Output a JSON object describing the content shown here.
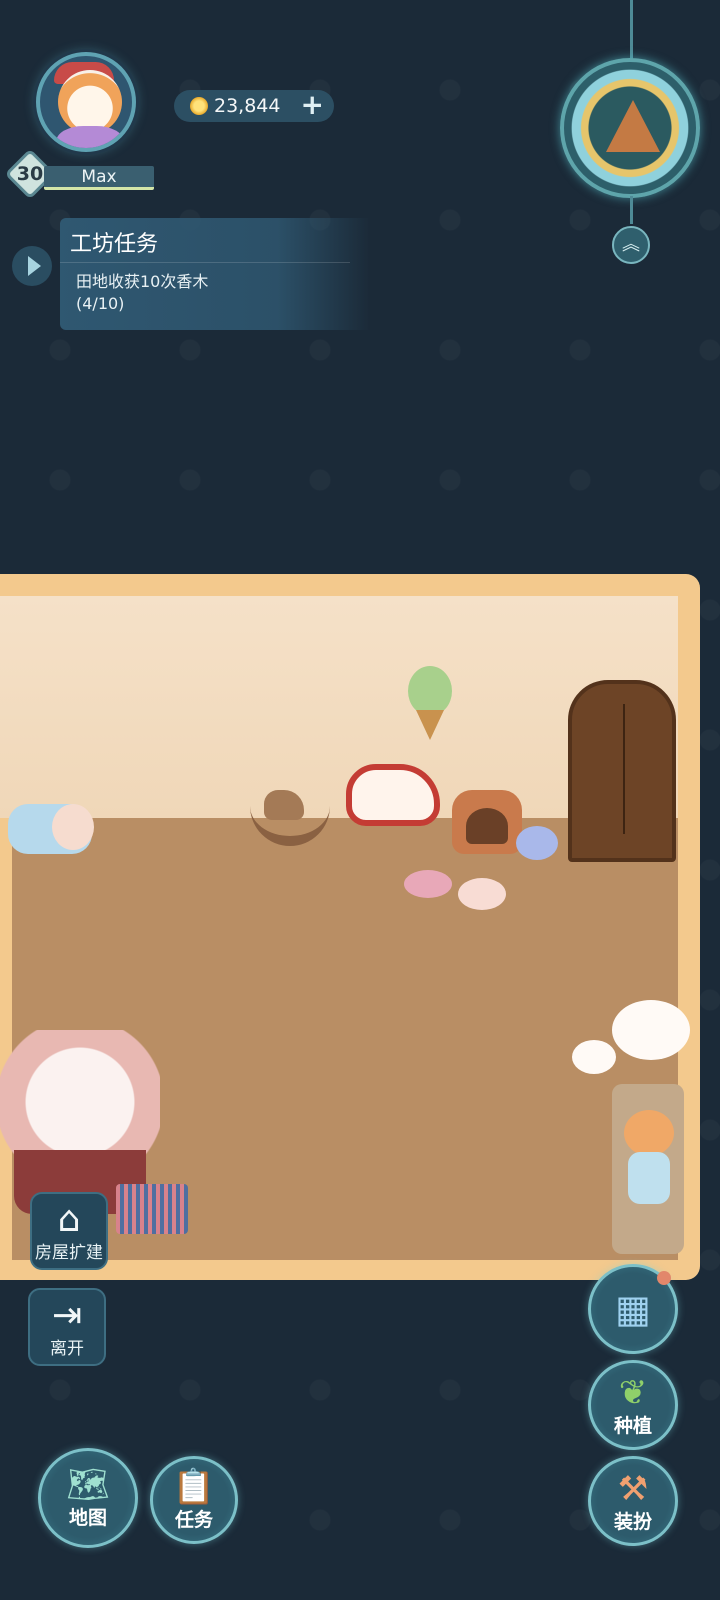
{
  "player": {
    "level": "30",
    "name": "Max"
  },
  "currency": {
    "coins": "23,844",
    "add_label": "+"
  },
  "quest": {
    "title": "工坊任务",
    "description": "田地收获10次香木",
    "progress": "(4/10)"
  },
  "buttons": {
    "house_expand": "房屋扩建",
    "leave": "离开",
    "plant": "种植",
    "dressup": "装扮",
    "map": "地图",
    "task": "任务"
  },
  "icons": {
    "house": "house-icon",
    "leave": "exit-icon",
    "layout": "layout-icon",
    "plant": "sprout-icon",
    "dressup": "hammer-icon",
    "map": "map-icon",
    "task": "clipboard-icon",
    "expand": "chevron-up-icon"
  },
  "colors": {
    "background": "#1b2a38",
    "room_frame": "#f3c98d",
    "floor": "#b98e64",
    "accent": "#7cc0c8",
    "notification": "#e2876b"
  }
}
